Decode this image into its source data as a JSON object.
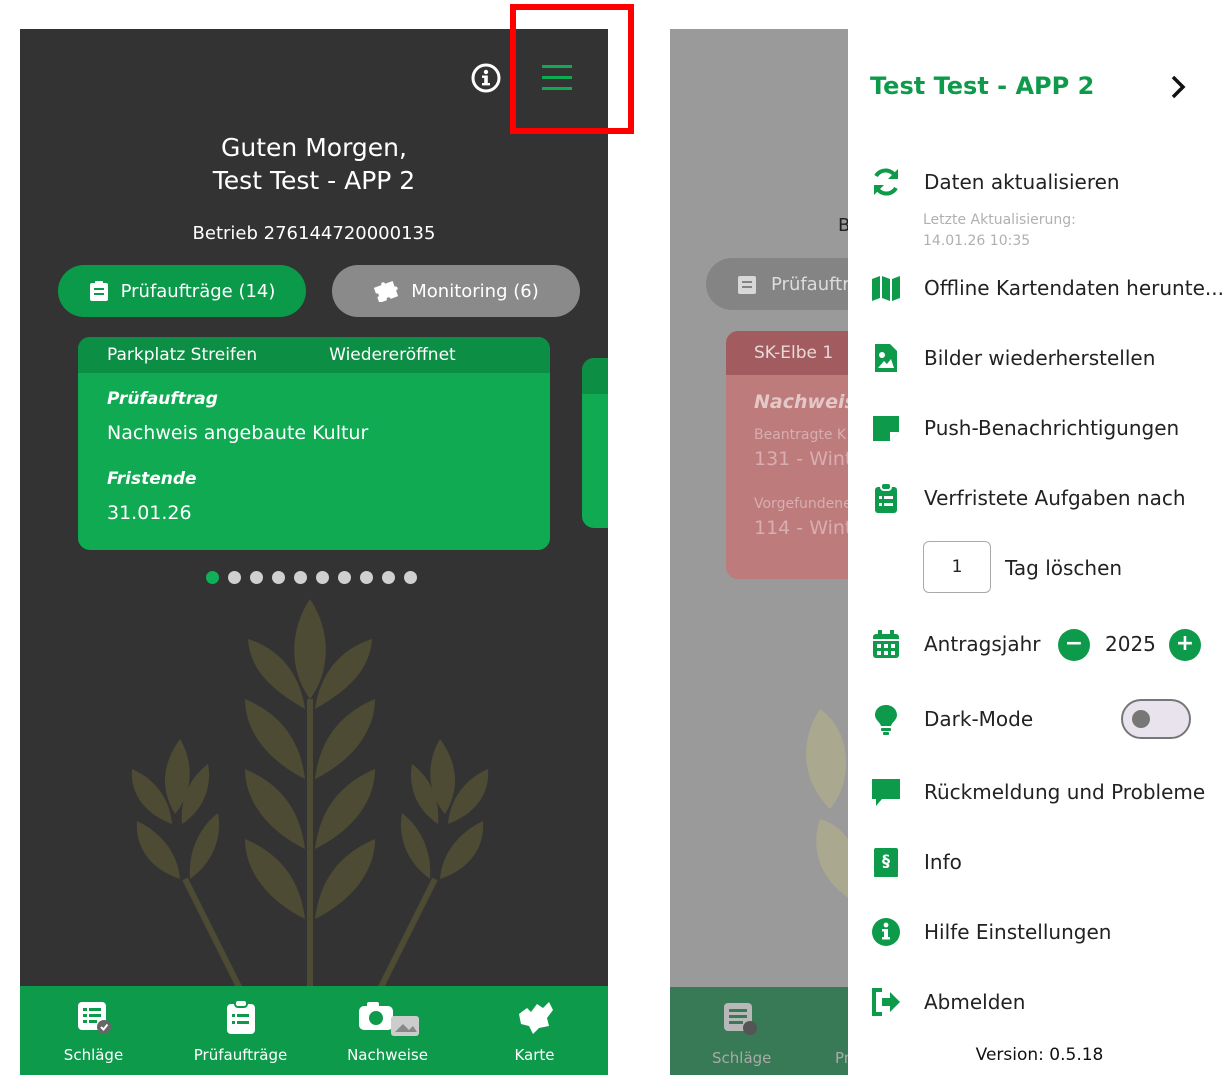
{
  "left": {
    "greeting_line1": "Guten Morgen,",
    "greeting_line2": "Test Test - APP 2",
    "betrieb": "Betrieb 276144720000135",
    "tabs": {
      "pruefauftraege": "Prüfaufträge (14)",
      "monitoring": "Monitoring (6)"
    },
    "card": {
      "location": "Parkplatz Streifen",
      "status": "Wiedereröffnet",
      "type_label": "Prüfauftrag",
      "type_value": "Nachweis angebaute Kultur",
      "deadline_label": "Fristende",
      "deadline_value": "31.01.26"
    },
    "carousel": {
      "count": 10,
      "active_index": 0
    },
    "nav": [
      {
        "label": "Schläge",
        "icon": "fields-icon"
      },
      {
        "label": "Prüfaufträge",
        "icon": "clipboard-icon"
      },
      {
        "label": "Nachweise",
        "icon": "camera-icon"
      },
      {
        "label": "Karte",
        "icon": "map-saxony-icon"
      }
    ]
  },
  "right": {
    "background": {
      "letter_b": "B",
      "tab_text": "Prüfauftr",
      "card_title": "SK-Elbe 1",
      "card_label": "Nachweis",
      "row1_label": "Beantragte K",
      "row1_value": "131 - Wint",
      "row2_label": "Vorgefundene",
      "row2_value": "114 - Wint",
      "nav_label1": "Schläge",
      "nav_label2": "Pr"
    },
    "drawer": {
      "title": "Test Test - APP 2",
      "items": [
        {
          "label": "Daten aktualisieren",
          "icon": "refresh-icon"
        },
        {
          "label": "Offline Kartendaten herunte...",
          "icon": "map-icon"
        },
        {
          "label": "Bilder wiederherstellen",
          "icon": "image-file-icon"
        },
        {
          "label": "Push-Benachrichtigungen",
          "icon": "sticky-note-icon"
        },
        {
          "label": "Verfristete Aufgaben nach",
          "icon": "clipboard-list-icon"
        },
        {
          "label": "Antragsjahr",
          "icon": "calendar-icon"
        },
        {
          "label": "Dark-Mode",
          "icon": "lightbulb-icon"
        },
        {
          "label": "Rückmeldung und Probleme",
          "icon": "comment-icon"
        },
        {
          "label": "Info",
          "icon": "paragraph-book-icon"
        },
        {
          "label": "Hilfe Einstellungen",
          "icon": "info-circle-icon"
        },
        {
          "label": "Abmelden",
          "icon": "logout-icon"
        }
      ],
      "last_update_label": "Letzte Aktualisierung:",
      "last_update_value": "14.01.26 10:35",
      "days_value": "1",
      "days_suffix": "Tag löschen",
      "year": "2025",
      "dark_mode": false,
      "version": "Version: 0.5.18"
    }
  },
  "colors": {
    "brand_green": "#0e9a4b",
    "highlight": "#ff0000"
  }
}
